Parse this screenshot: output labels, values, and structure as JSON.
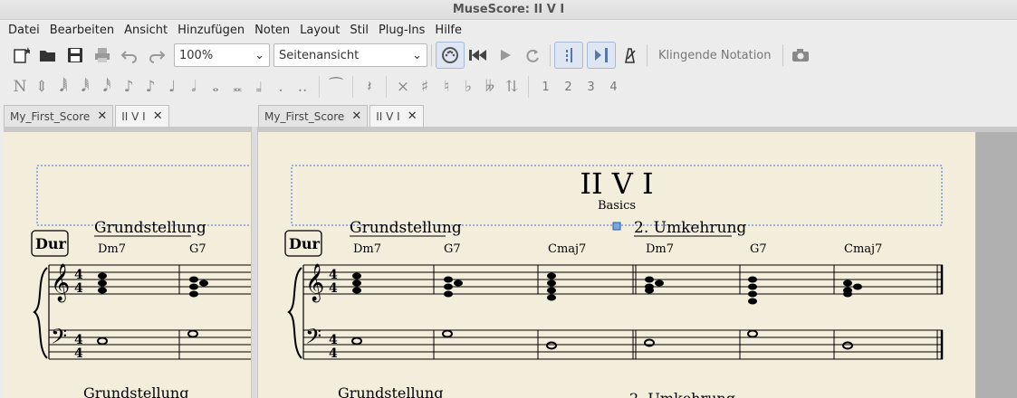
{
  "window": {
    "title": "MuseScore: II V I"
  },
  "menu": [
    "Datei",
    "Bearbeiten",
    "Ansicht",
    "Hinzufügen",
    "Noten",
    "Layout",
    "Stil",
    "Plug-Ins",
    "Hilfe"
  ],
  "toolbar": {
    "zoom": "100%",
    "view_mode": "Seitenansicht",
    "concert_pitch": "Klingende Notation"
  },
  "voices": [
    "1",
    "2",
    "3",
    "4"
  ],
  "tabs_left": [
    {
      "label": "My_First_Score"
    },
    {
      "label": "II V I"
    }
  ],
  "tabs_right": [
    {
      "label": "My_First_Score"
    },
    {
      "label": "II V I"
    }
  ],
  "score": {
    "title": "II V I",
    "subtitle": "Basics",
    "key_box": "Dur",
    "section1": "Grundstellung",
    "section2": "2. Umkehrung",
    "time_signature": "4",
    "chords": [
      "Dm7",
      "G7",
      "Cmaj7",
      "Dm7",
      "G7",
      "Cmaj7"
    ],
    "next_system_label_1": "Grundstellung",
    "next_system_label_2": "2. Umkehrung"
  },
  "colors": {
    "paper": "#f3eddb",
    "selection": "#3b6fd4",
    "background": "#ececec"
  }
}
